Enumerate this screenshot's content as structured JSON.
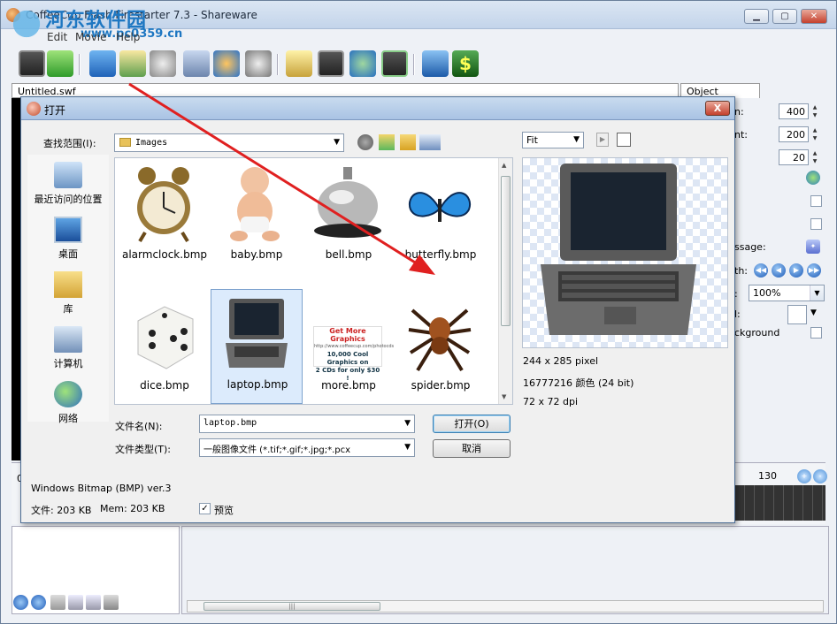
{
  "app": {
    "title": "CoffeeCup Flash Firestarter 7.3 - Shareware",
    "menu": [
      "Edit",
      "Movie",
      "Help"
    ],
    "doc_tab": "Untitled.swf",
    "prop_tab": "Object Properties",
    "watermark_text": "河东软件园",
    "watermark_url": "www.pc0359.cn"
  },
  "props": {
    "row1_label": "n:",
    "row1_value": "400",
    "row2_label": "nt:",
    "row2_value": "200",
    "row3_value": "20",
    "message_label": "ssage:",
    "width_label": "th:",
    "zoom_label": ":",
    "zoom_value": "100%",
    "color_label": "l:",
    "background_label": "ckground"
  },
  "timeline": {
    "frame_number": "130",
    "frame_zero": "0"
  },
  "dialog": {
    "title": "打开",
    "close": "X",
    "look_in_label": "查找范围(I):",
    "look_in_value": "Images",
    "places": [
      "最近访问的位置",
      "桌面",
      "库",
      "计算机",
      "网络"
    ],
    "files": [
      "alarmclock.bmp",
      "baby.bmp",
      "bell.bmp",
      "butterfly.bmp",
      "dice.bmp",
      "laptop.bmp",
      "more.bmp",
      "spider.bmp"
    ],
    "selected_file": "laptop.bmp",
    "more_ad": {
      "line1": "Get More Graphics",
      "line2": "http://www.coffeecup.com/photocds",
      "line3": "10,000 Cool Graphics on",
      "line4": "2 CDs for only $30 !"
    },
    "filename_label": "文件名(N):",
    "filename_value": "laptop.bmp",
    "filetype_label": "文件类型(T):",
    "filetype_value": "一般图像文件 (*.tif;*.gif;*.jpg;*.pcx",
    "open_button": "打开(O)",
    "cancel_button": "取消",
    "format_info": "Windows Bitmap (BMP) ver.3",
    "file_size": "文件: 203 KB",
    "mem_size": "Mem: 203 KB",
    "preview_label": "预览",
    "preview_checked": true,
    "fit_value": "Fit",
    "image_size": "244 x 285 pixel",
    "image_colors": "16777216 颜色 (24 bit)",
    "image_dpi": "72 x 72 dpi"
  }
}
